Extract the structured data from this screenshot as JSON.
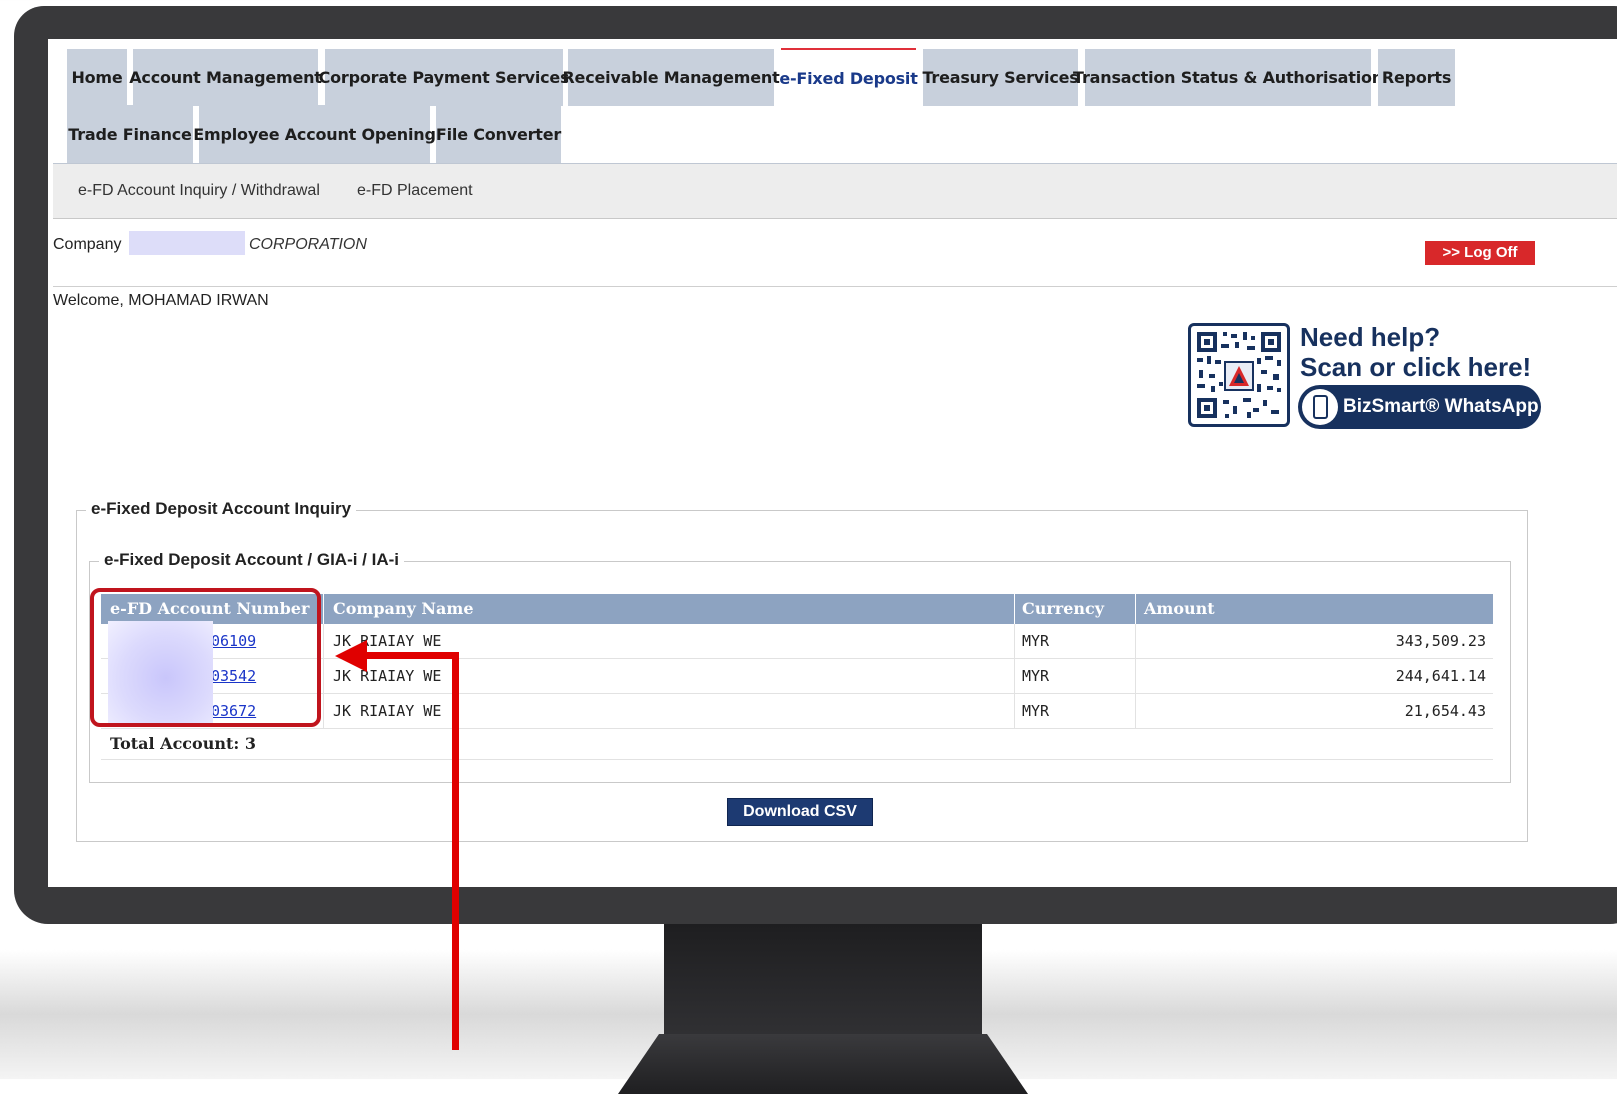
{
  "tabs": [
    {
      "label": "Home",
      "active": false
    },
    {
      "label": "Account Management",
      "active": false
    },
    {
      "label": "Corporate Payment Services",
      "active": false
    },
    {
      "label": "Receivable Management",
      "active": false
    },
    {
      "label": "e-Fixed Deposit",
      "active": true
    },
    {
      "label": "Treasury Services",
      "active": false
    },
    {
      "label": "Transaction Status & Authorisation",
      "active": false
    },
    {
      "label": "Reports",
      "active": false
    },
    {
      "label": "Trade Finance",
      "active": false
    },
    {
      "label": "Employee Account Opening",
      "active": false
    },
    {
      "label": "File Converter",
      "active": false
    }
  ],
  "subnav": [
    "e-FD Account Inquiry / Withdrawal",
    "e-FD Placement"
  ],
  "header": {
    "company_label": "Company",
    "company_name": "CORPORATION",
    "logoff_label": ">> Log Off",
    "welcome": "Welcome, MOHAMAD IRWAN"
  },
  "help_banner": {
    "title": "Need help?",
    "subtitle": "Scan or click here!",
    "whatsapp_label": "BizSmart® WhatsApp",
    "icon": "qr-code-icon"
  },
  "inquiry": {
    "outer_legend": "e-Fixed Deposit Account Inquiry",
    "inner_legend": "e-Fixed Deposit Account / GIA-i / IA-i",
    "columns": [
      "e-FD Account Number",
      "Company Name",
      "Currency",
      "Amount"
    ],
    "rows": [
      {
        "account": "06109",
        "company": "JK RIAIAY WE",
        "currency": "MYR",
        "amount": "343,509.23"
      },
      {
        "account": "03542",
        "company": "JK RIAIAY WE",
        "currency": "MYR",
        "amount": "244,641.14"
      },
      {
        "account": "03672",
        "company": "JK RIAIAY WE",
        "currency": "MYR",
        "amount": "21,654.43"
      }
    ],
    "total_label": "Total Account: 3",
    "download_label": "Download CSV"
  },
  "colors": {
    "tab_bg": "#c8d0dc",
    "table_header": "#8da3c1",
    "logoff": "#d8282a",
    "brand_navy": "#17315e",
    "annotation_red": "#e00000"
  }
}
